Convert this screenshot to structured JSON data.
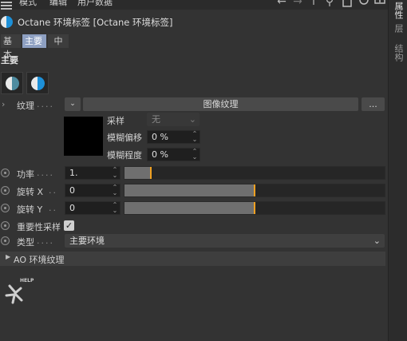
{
  "menubar": {
    "items": [
      "模式",
      "编辑",
      "用户数据"
    ]
  },
  "title": "Octane 环境标签 [Octane 环境标签]",
  "tabs": [
    {
      "label": "基本",
      "active": false
    },
    {
      "label": "主要",
      "active": true
    },
    {
      "label": "中",
      "active": false
    }
  ],
  "side_tabs": [
    {
      "label": "属性",
      "active": true
    },
    {
      "label": "层",
      "active": false
    },
    {
      "label": "结构",
      "active": false
    }
  ],
  "section": "主要",
  "texture": {
    "label": "纹理",
    "dots": "....",
    "button": "图像纹理",
    "more": "...",
    "sampling_label": "采样",
    "sampling_value": "无",
    "blur_offset_label": "模糊偏移",
    "blur_offset_value": "0 %",
    "blur_degree_label": "模糊程度",
    "blur_degree_value": "0 %"
  },
  "power": {
    "label": "功率",
    "dots": "....",
    "value": "1.",
    "level": 0.1
  },
  "rotate_x": {
    "label": "旋转 X",
    "dots": "..",
    "value": "0",
    "level": 0.5
  },
  "rotate_y": {
    "label": "旋转 Y",
    "dots": "..",
    "value": "0",
    "level": 0.5
  },
  "importance": {
    "label": "重要性采样",
    "checked": true,
    "check_glyph": "✓"
  },
  "type": {
    "label": "类型",
    "dots": "....",
    "value": "主要环境"
  },
  "ao": {
    "label": "AO 环境纹理"
  },
  "help": {
    "label": "HELP"
  },
  "colors": {
    "accent": "#1d90d8",
    "handle": "#f0a020",
    "tab_active": "#8d9fc1"
  }
}
